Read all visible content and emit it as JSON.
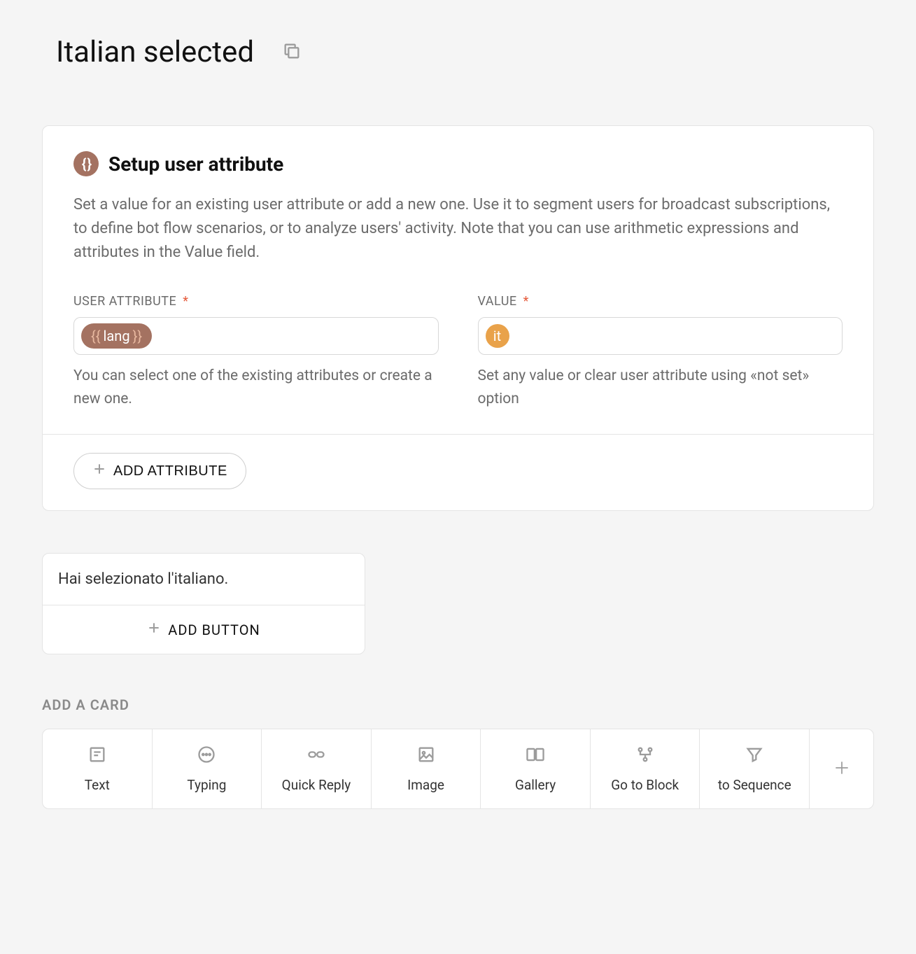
{
  "page": {
    "title": "Italian selected"
  },
  "setup_card": {
    "title": "Setup user attribute",
    "description": "Set a value for an existing user attribute or add a new one. Use it to segment users for broadcast subscriptions, to define bot flow scenarios, or to analyze users' activity. Note that you can use arithmetic expressions and attributes in the Value field.",
    "user_attr_label": "USER ATTRIBUTE",
    "value_label": "VALUE",
    "required_mark": "*",
    "user_attr_chip": "lang",
    "value_chip": "it",
    "user_attr_help": "You can select one of the existing attributes or create a new one.",
    "value_help": "Set any value or clear user attribute using «not set» option",
    "add_attr_label": "ADD ATTRIBUTE"
  },
  "message_card": {
    "text": "Hai selezionato l'italiano.",
    "add_button_label": "ADD BUTTON"
  },
  "add_card_section": {
    "heading": "ADD A CARD",
    "items": [
      {
        "label": "Text"
      },
      {
        "label": "Typing"
      },
      {
        "label": "Quick Reply"
      },
      {
        "label": "Image"
      },
      {
        "label": "Gallery"
      },
      {
        "label": "Go to Block"
      },
      {
        "label": "to Sequence"
      }
    ]
  }
}
